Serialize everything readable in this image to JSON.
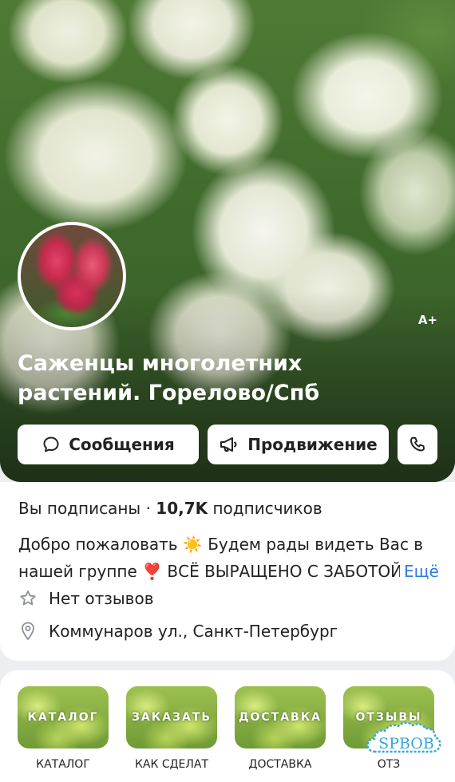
{
  "cover": {
    "badge_text": "A+",
    "title": "Саженцы многолетних растений. Горелово/Спб"
  },
  "actions": {
    "messages_label": "Сообщения",
    "promotion_label": "Продвижение",
    "call_icon": "phone-icon"
  },
  "info": {
    "subscribed_status": "Вы подписаны",
    "separator": "·",
    "subscribers_count": "10,7K",
    "subscribers_label": "подписчиков",
    "description_line1": "Добро пожаловать ☀️ Будем рады видеть Вас в",
    "description_line2": "нашей группе ❣️ ВСЁ ВЫРАЩЕНО С ЗАБОТОЙ",
    "more_label": "Ещё",
    "reviews": "Нет отзывов",
    "address": "Коммунаров ул., Санкт-Петербург"
  },
  "tiles": [
    {
      "image_text": "КАТАЛОГ",
      "caption": "КАТАЛОГ"
    },
    {
      "image_text": "ЗАКАЗАТЬ",
      "caption": "КАК СДЕЛАТ"
    },
    {
      "image_text": "ДОСТАВКА",
      "caption": "ДОСТАВКА"
    },
    {
      "image_text": "ОТЗЫВЫ",
      "caption": "ОТЗ"
    }
  ],
  "watermark": {
    "text": "SPBOB",
    "color": "#39a6d8"
  },
  "colors": {
    "link": "#2f7cd8",
    "page_bg": "#eceef1"
  }
}
